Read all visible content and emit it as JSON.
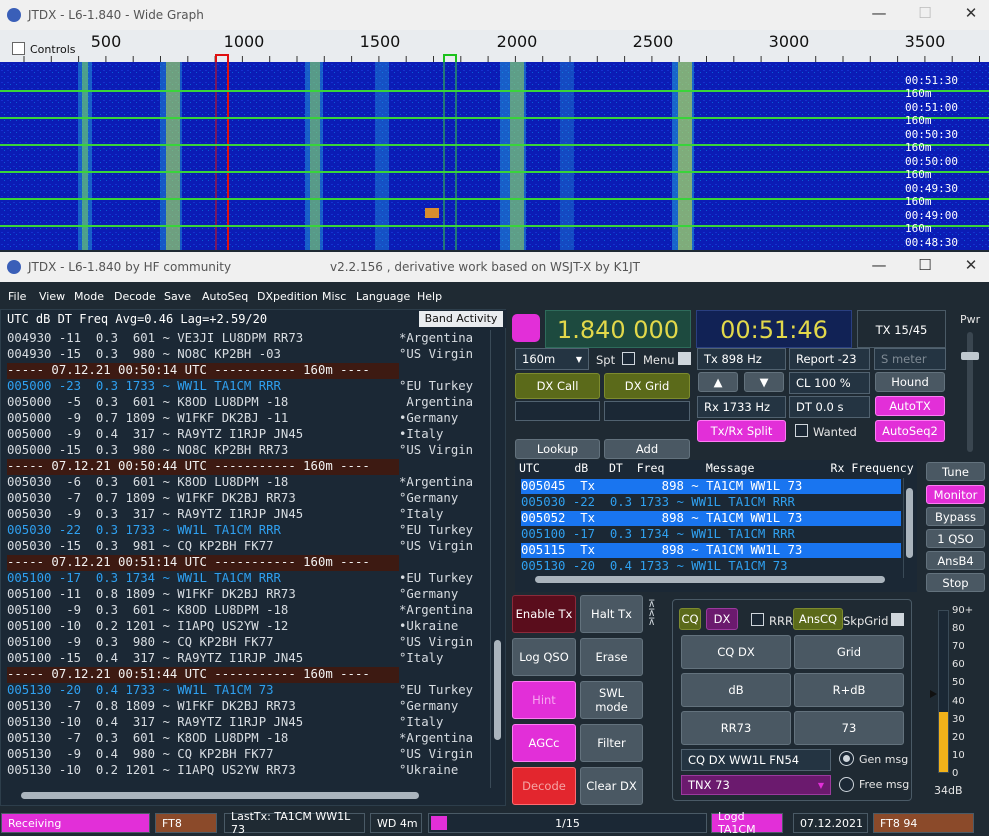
{
  "wide_graph": {
    "title": "JTDX - L6-1.840 - Wide Graph",
    "controls_label": "Controls",
    "ruler": [
      "500",
      "1000",
      "1500",
      "2000",
      "2500",
      "3000",
      "3500"
    ],
    "times": [
      "00:51:30",
      "00:51:00",
      "00:50:30",
      "00:50:00",
      "00:49:30",
      "00:49:00",
      "00:48:30"
    ],
    "band": "160m"
  },
  "main": {
    "title": "JTDX - L6-1.840  by HF community",
    "subtitle": "v2.2.156 , derivative work based on WSJT-X by K1JT"
  },
  "menu": [
    "File",
    "View",
    "Mode",
    "Decode",
    "Save",
    "AutoSeq",
    "DXpedition",
    "Misc",
    "Language",
    "Help"
  ],
  "band_activity": {
    "label": "Band Activity",
    "header": "UTC     dB   DT Freq    Avg=0.46 Lag=+2.59/20",
    "lines": [
      {
        "t": "004930 -11  0.3  601 ~ VE3JI LU8DPM RR73",
        "c": "*Argentina",
        "k": "n"
      },
      {
        "t": "004930 -15  0.3  980 ~ NO8C KP2BH -03",
        "c": "°US Virgin",
        "k": "n"
      },
      {
        "t": "----- 07.12.21 00:50:14 UTC ----------- 160m ----",
        "c": "",
        "k": "sep"
      },
      {
        "t": "005000 -23  0.3 1733 ~ WW1L TA1CM RRR",
        "c": "°EU Turkey",
        "k": "me"
      },
      {
        "t": "005000  -5  0.3  601 ~ K8OD LU8DPM -18",
        "c": " Argentina",
        "k": "n"
      },
      {
        "t": "005000  -9  0.7 1809 ~ W1FKF DK2BJ -11",
        "c": "•Germany",
        "k": "n"
      },
      {
        "t": "005000  -9  0.4  317 ~ RA9YTZ I1RJP JN45",
        "c": "•Italy",
        "k": "n"
      },
      {
        "t": "005000 -15  0.3  980 ~ NO8C KP2BH RR73",
        "c": "°US Virgin",
        "k": "n"
      },
      {
        "t": "----- 07.12.21 00:50:44 UTC ----------- 160m ----",
        "c": "",
        "k": "sep"
      },
      {
        "t": "005030  -6  0.3  601 ~ K8OD LU8DPM -18",
        "c": "*Argentina",
        "k": "n"
      },
      {
        "t": "005030  -7  0.7 1809 ~ W1FKF DK2BJ RR73",
        "c": "°Germany",
        "k": "n"
      },
      {
        "t": "005030  -9  0.3  317 ~ RA9YTZ I1RJP JN45",
        "c": "°Italy",
        "k": "n"
      },
      {
        "t": "005030 -22  0.3 1733 ~ WW1L TA1CM RRR",
        "c": "°EU Turkey",
        "k": "me"
      },
      {
        "t": "005030 -15  0.3  981 ~ CQ KP2BH FK77",
        "c": "°US Virgin",
        "k": "n"
      },
      {
        "t": "----- 07.12.21 00:51:14 UTC ----------- 160m ----",
        "c": "",
        "k": "sep"
      },
      {
        "t": "005100 -17  0.3 1734 ~ WW1L TA1CM RRR",
        "c": "•EU Turkey",
        "k": "me"
      },
      {
        "t": "005100 -11  0.8 1809 ~ W1FKF DK2BJ RR73",
        "c": "°Germany",
        "k": "n"
      },
      {
        "t": "005100  -9  0.3  601 ~ K8OD LU8DPM -18",
        "c": "*Argentina",
        "k": "n"
      },
      {
        "t": "005100 -10  0.2 1201 ~ I1APQ US2YW -12",
        "c": "•Ukraine",
        "k": "n"
      },
      {
        "t": "005100  -9  0.3  980 ~ CQ KP2BH FK77",
        "c": "°US Virgin",
        "k": "n"
      },
      {
        "t": "005100 -15  0.4  317 ~ RA9YTZ I1RJP JN45",
        "c": "°Italy",
        "k": "n"
      },
      {
        "t": "----- 07.12.21 00:51:44 UTC ----------- 160m ----",
        "c": "",
        "k": "sep"
      },
      {
        "t": "005130 -20  0.4 1733 ~ WW1L TA1CM 73",
        "c": "°EU Turkey",
        "k": "me"
      },
      {
        "t": "005130  -7  0.8 1809 ~ W1FKF DK2BJ RR73",
        "c": "°Germany",
        "k": "n"
      },
      {
        "t": "005130 -10  0.4  317 ~ RA9YTZ I1RJP JN45",
        "c": "°Italy",
        "k": "n"
      },
      {
        "t": "005130  -7  0.3  601 ~ K8OD LU8DPM -18",
        "c": "*Argentina",
        "k": "n"
      },
      {
        "t": "005130  -9  0.4  980 ~ CQ KP2BH FK77",
        "c": "°US Virgin",
        "k": "n"
      },
      {
        "t": "005130 -10  0.2 1201 ~ I1APQ US2YW RR73",
        "c": "°Ukraine",
        "k": "n"
      }
    ]
  },
  "freq": "1.840 000",
  "clock": "00:51:46",
  "tx_period": "TX 15/45",
  "pwr": "Pwr",
  "band_select": "160m",
  "spt": "Spt",
  "menu_label": "Menu",
  "tx_freq": "Tx  898  Hz",
  "report": "Report -23",
  "smeter": "S meter",
  "dx_call": "DX Call",
  "dx_grid": "DX Grid",
  "cl": "CL  100 %",
  "hound": "Hound",
  "rx_freq": "Rx  1733  Hz",
  "dt": "DT 0.0 s",
  "autotx": "AutoTX",
  "txrx_split": "Tx/Rx Split",
  "wanted": "Wanted",
  "autoseq2": "AutoSeq2",
  "lookup": "Lookup",
  "add": "Add",
  "rx_header": "UTC     dB   DT  Freq      Message           Rx Frequency",
  "rx_lines": [
    {
      "t": "005045  Tx         898 ~ TA1CM WW1L 73",
      "hl": true
    },
    {
      "t": "005030 -22  0.3 1733 ~ WW1L TA1CM RRR",
      "hl": false
    },
    {
      "t": "005052  Tx         898 ~ TA1CM WW1L 73",
      "hl": true
    },
    {
      "t": "005100 -17  0.3 1734 ~ WW1L TA1CM RRR",
      "hl": false
    },
    {
      "t": "005115  Tx         898 ~ TA1CM WW1L 73",
      "hl": true
    },
    {
      "t": "005130 -20  0.4 1733 ~ WW1L TA1CM 73",
      "hl": false
    }
  ],
  "side_buttons": [
    "Tune",
    "Monitor",
    "Bypass",
    "1 QSO",
    "AnsB4",
    "Stop"
  ],
  "left_buttons": {
    "enable_tx": "Enable Tx",
    "halt_tx": "Halt Tx",
    "log_qso": "Log QSO",
    "erase": "Erase",
    "hint": "Hint",
    "swl": "SWL mode",
    "agcc": "AGCc",
    "filter": "Filter",
    "decode": "Decode",
    "clear_dx": "Clear DX"
  },
  "msg_panel": {
    "cq": "CQ",
    "dx": "DX",
    "rrr": "RRR",
    "anscq": "AnsCQ",
    "skpgrid": "SkpGrid",
    "btns": [
      "CQ DX",
      "Grid",
      "dB",
      "R+dB",
      "RR73",
      "73"
    ],
    "cq_msg": "CQ DX WW1L FN54",
    "tnx": "TNX 73",
    "gen_msg": "Gen msg",
    "free_msg": "Free msg"
  },
  "meter": {
    "ticks": [
      "90+",
      "80",
      "70",
      "60",
      "50",
      "40",
      "30",
      "20",
      "10",
      "0"
    ],
    "value_db": "34dB",
    "level": 0.37
  },
  "status": {
    "state": "Receiving",
    "mode": "FT8",
    "lasttx": "LastTx: TA1CM WW1L 73",
    "wd": "WD 4m",
    "progress": "1/15",
    "logd": "Logd TA1CM",
    "date": "07.12.2021",
    "mode2": "FT8  94"
  },
  "colors": {
    "accent_pink": "#e22fd8",
    "olive": "#5b6a1a",
    "waterfall": "#0a1ab0",
    "grid_green": "#39d43a"
  }
}
